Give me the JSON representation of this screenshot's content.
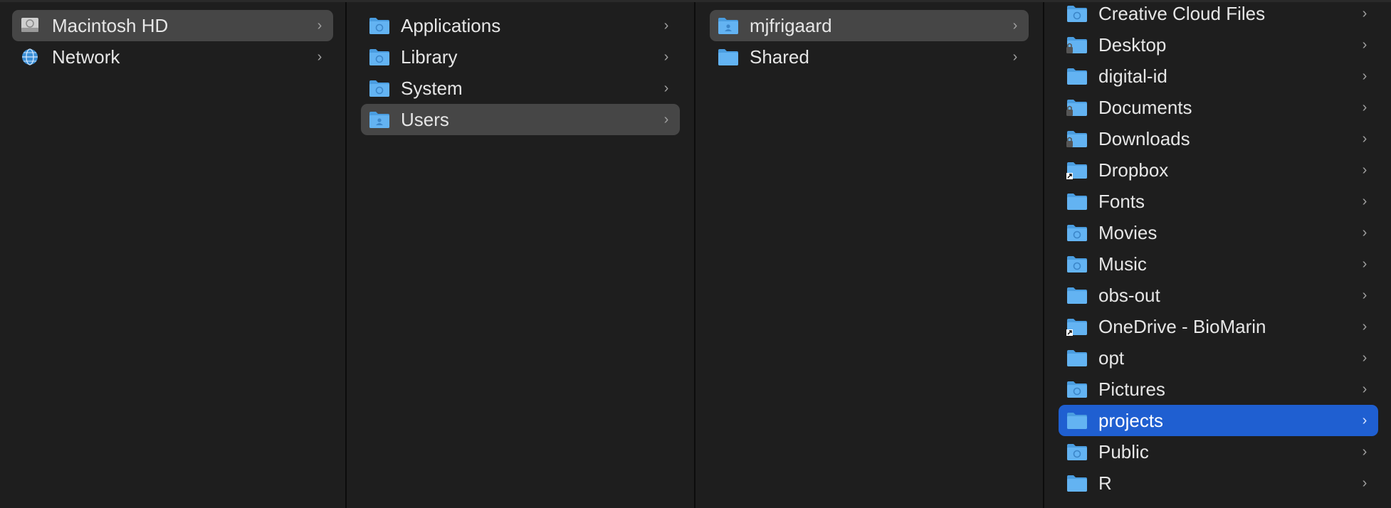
{
  "columns": [
    {
      "items": [
        {
          "label": "Macintosh HD",
          "icon": "hard-drive-icon",
          "selected": "gray"
        },
        {
          "label": "Network",
          "icon": "network-globe-icon",
          "selected": ""
        }
      ]
    },
    {
      "items": [
        {
          "label": "Applications",
          "icon": "applications-folder-icon",
          "selected": ""
        },
        {
          "label": "Library",
          "icon": "library-folder-icon",
          "selected": ""
        },
        {
          "label": "System",
          "icon": "system-folder-icon",
          "selected": ""
        },
        {
          "label": "Users",
          "icon": "users-folder-icon",
          "selected": "gray"
        }
      ]
    },
    {
      "items": [
        {
          "label": "mjfrigaard",
          "icon": "home-folder-icon",
          "selected": "gray"
        },
        {
          "label": "Shared",
          "icon": "folder-icon",
          "selected": ""
        }
      ]
    },
    {
      "items": [
        {
          "label": "Creative Cloud Files",
          "icon": "creative-cloud-folder-icon",
          "selected": ""
        },
        {
          "label": "Desktop",
          "icon": "desktop-folder-icon",
          "selected": ""
        },
        {
          "label": "digital-id",
          "icon": "folder-icon",
          "selected": ""
        },
        {
          "label": "Documents",
          "icon": "documents-folder-icon",
          "selected": ""
        },
        {
          "label": "Downloads",
          "icon": "downloads-folder-icon",
          "selected": ""
        },
        {
          "label": "Dropbox",
          "icon": "alias-folder-icon",
          "selected": ""
        },
        {
          "label": "Fonts",
          "icon": "folder-icon",
          "selected": ""
        },
        {
          "label": "Movies",
          "icon": "movies-folder-icon",
          "selected": ""
        },
        {
          "label": "Music",
          "icon": "music-folder-icon",
          "selected": ""
        },
        {
          "label": "obs-out",
          "icon": "folder-icon",
          "selected": ""
        },
        {
          "label": "OneDrive - BioMarin",
          "icon": "alias-folder-icon",
          "selected": ""
        },
        {
          "label": "opt",
          "icon": "folder-icon",
          "selected": ""
        },
        {
          "label": "Pictures",
          "icon": "pictures-folder-icon",
          "selected": ""
        },
        {
          "label": "projects",
          "icon": "folder-icon",
          "selected": "blue"
        },
        {
          "label": "Public",
          "icon": "public-folder-icon",
          "selected": ""
        },
        {
          "label": "R",
          "icon": "folder-icon",
          "selected": ""
        }
      ]
    }
  ],
  "colors": {
    "background": "#1e1e1e",
    "selection_gray": "#464646",
    "selection_blue": "#1f5fd1",
    "folder_blue": "#5aaef0"
  }
}
